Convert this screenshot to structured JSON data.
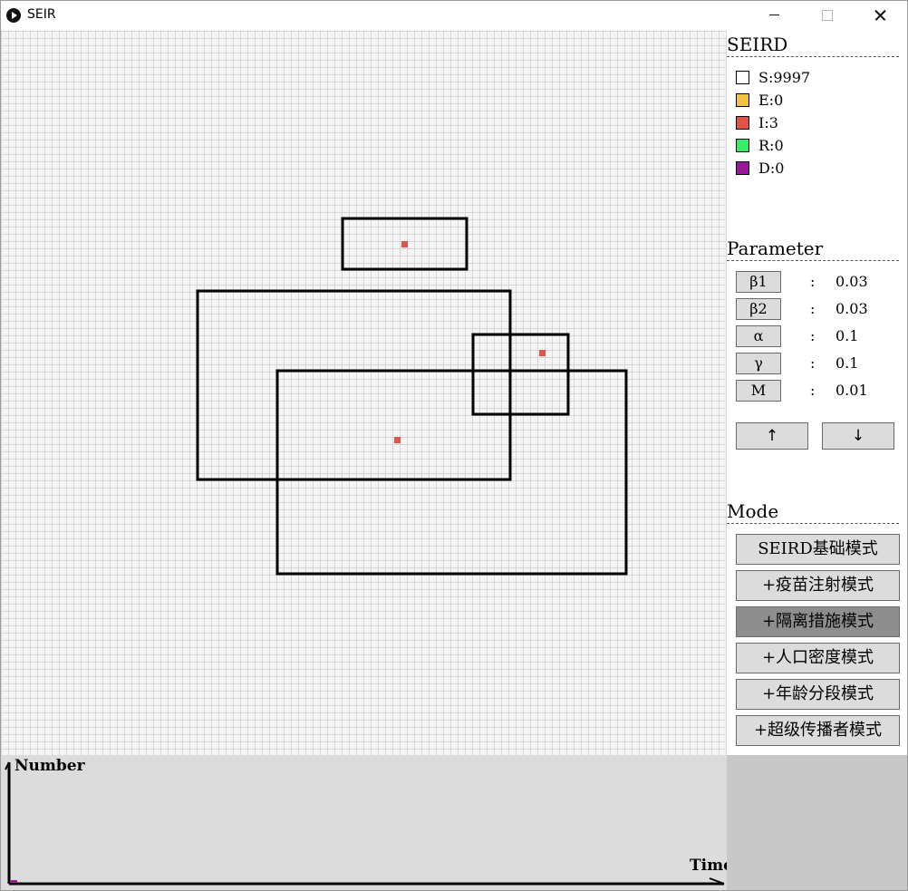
{
  "window": {
    "title": "SEIR"
  },
  "seird": {
    "heading": "SEIRD",
    "items": [
      {
        "label": "S:9997",
        "color": "#ffffff"
      },
      {
        "label": "E:0",
        "color": "#f2c341"
      },
      {
        "label": "I:3",
        "color": "#e0524a"
      },
      {
        "label": "R:0",
        "color": "#33ee66"
      },
      {
        "label": "D:0",
        "color": "#9b169e"
      }
    ]
  },
  "parameter": {
    "heading": "Parameter",
    "items": [
      {
        "name": "β1",
        "colon": ":",
        "value": "0.03"
      },
      {
        "name": "β2",
        "colon": ":",
        "value": "0.03"
      },
      {
        "name": "α",
        "colon": ":",
        "value": "0.1"
      },
      {
        "name": "γ",
        "colon": ":",
        "value": "0.1"
      },
      {
        "name": "M",
        "colon": ":",
        "value": "0.01"
      }
    ],
    "up_label": "↑",
    "down_label": "↓"
  },
  "mode": {
    "heading": "Mode",
    "buttons": [
      {
        "label": "SEIRD基础模式",
        "active": false
      },
      {
        "label": "+疫苗注射模式",
        "active": false
      },
      {
        "label": "+隔离措施模式",
        "active": true
      },
      {
        "label": "+人口密度模式",
        "active": false
      },
      {
        "label": "+年龄分段模式",
        "active": false
      },
      {
        "label": "+超级传播者模式",
        "active": false
      }
    ]
  },
  "chart": {
    "ylabel": "Number",
    "xlabel": "Time"
  },
  "colors": {
    "infected_dot": "#e0524a",
    "active_mode": "#8e8e8e",
    "button_bg": "#dcdcdc"
  }
}
